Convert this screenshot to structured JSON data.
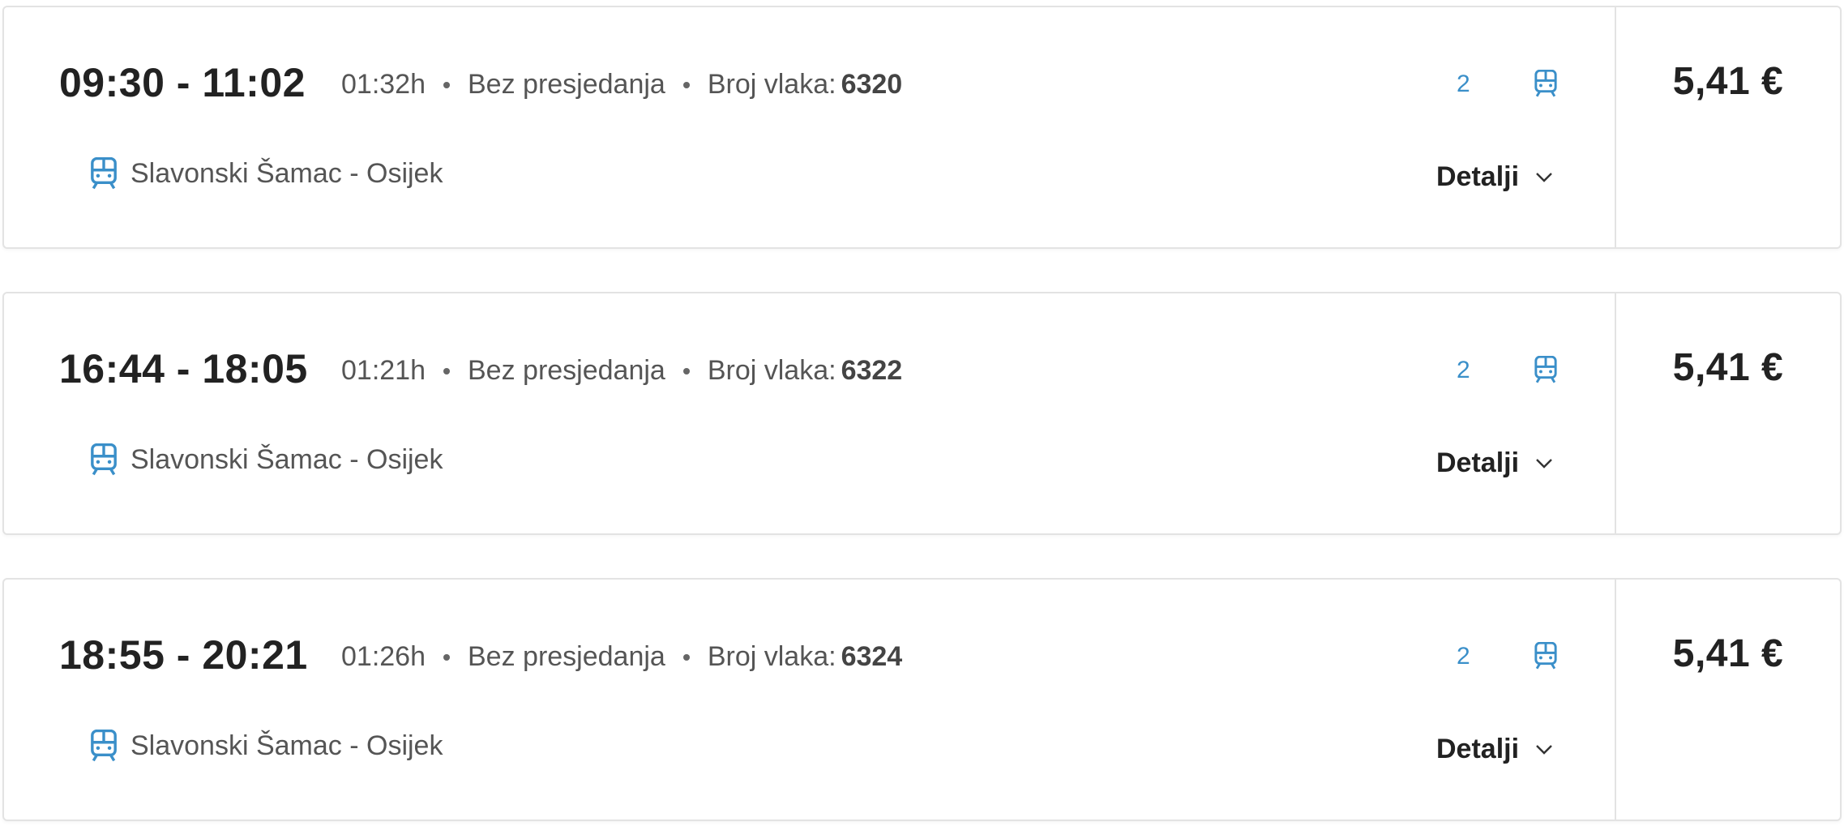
{
  "colors": {
    "accent": "#3a8fc9",
    "text_dark": "#222222",
    "text_muted": "#555555",
    "border": "#e3e3e3"
  },
  "results": [
    {
      "times": "09:30 - 11:02",
      "duration": "01:32h",
      "transfers": "Bez presjedanja",
      "train_label": "Broj vlaka:",
      "train_number": "6320",
      "class": "2",
      "route": "Slavonski Šamac - Osijek",
      "details_label": "Detalji",
      "price": "5,41 €",
      "icon": "train-icon"
    },
    {
      "times": "16:44 - 18:05",
      "duration": "01:21h",
      "transfers": "Bez presjedanja",
      "train_label": "Broj vlaka:",
      "train_number": "6322",
      "class": "2",
      "route": "Slavonski Šamac - Osijek",
      "details_label": "Detalji",
      "price": "5,41 €",
      "icon": "train-icon"
    },
    {
      "times": "18:55 - 20:21",
      "duration": "01:26h",
      "transfers": "Bez presjedanja",
      "train_label": "Broj vlaka:",
      "train_number": "6324",
      "class": "2",
      "route": "Slavonski Šamac - Osijek",
      "details_label": "Detalji",
      "price": "5,41 €",
      "icon": "train-icon"
    }
  ]
}
